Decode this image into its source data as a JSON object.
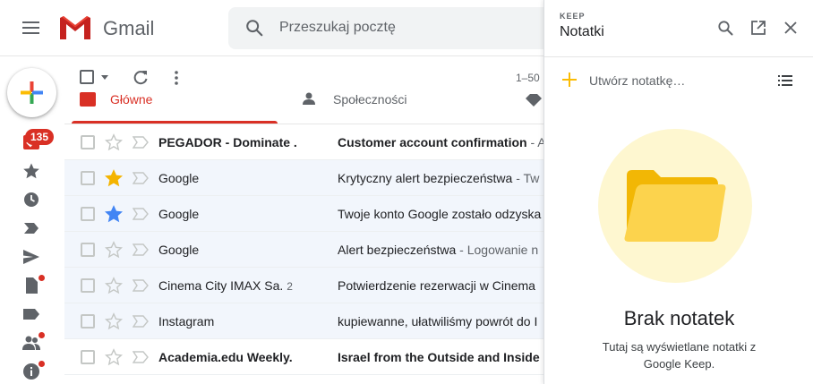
{
  "header": {
    "app_name": "Gmail",
    "search_placeholder": "Przeszukaj pocztę"
  },
  "nav": {
    "inbox_badge": "135"
  },
  "toolbar": {
    "pagination": "1–50"
  },
  "tabs": {
    "primary": "Główne",
    "social": "Społeczności"
  },
  "emails": [
    {
      "sender": "PEGADOR - Dominate .",
      "count": "",
      "subject": "Customer account confirmation",
      "snippet": " - Ac",
      "unread": true,
      "starred": "none"
    },
    {
      "sender": "Google",
      "count": "",
      "subject": "Krytyczny alert bezpieczeństwa",
      "snippet": " - Tw",
      "unread": false,
      "starred": "yellow"
    },
    {
      "sender": "Google",
      "count": "",
      "subject": "Twoje konto Google zostało odzyska",
      "snippet": "",
      "unread": false,
      "starred": "blue"
    },
    {
      "sender": "Google",
      "count": "",
      "subject": "Alert bezpieczeństwa",
      "snippet": " - Logowanie n",
      "unread": false,
      "starred": "none"
    },
    {
      "sender": "Cinema City IMAX Sa.",
      "count": "2",
      "subject": "Potwierdzenie rezerwacji w Cinema",
      "snippet": "",
      "unread": false,
      "starred": "none"
    },
    {
      "sender": "Instagram",
      "count": "",
      "subject": "kupiewanne, ułatwiliśmy powrót do I",
      "snippet": "",
      "unread": false,
      "starred": "none"
    },
    {
      "sender": "Academia.edu Weekly.",
      "count": "",
      "subject": "Israel from the Outside and Inside -",
      "snippet": "",
      "unread": true,
      "starred": "none"
    }
  ],
  "keep": {
    "subtitle": "KEEP",
    "title": "Notatki",
    "create_label": "Utwórz notatkę…",
    "empty_title": "Brak notatek",
    "empty_desc": "Tutaj są wyświetlane notatki z Google Keep."
  },
  "colors": {
    "accent_red": "#d93025",
    "star_yellow": "#f4b400",
    "star_blue": "#4285f4"
  }
}
